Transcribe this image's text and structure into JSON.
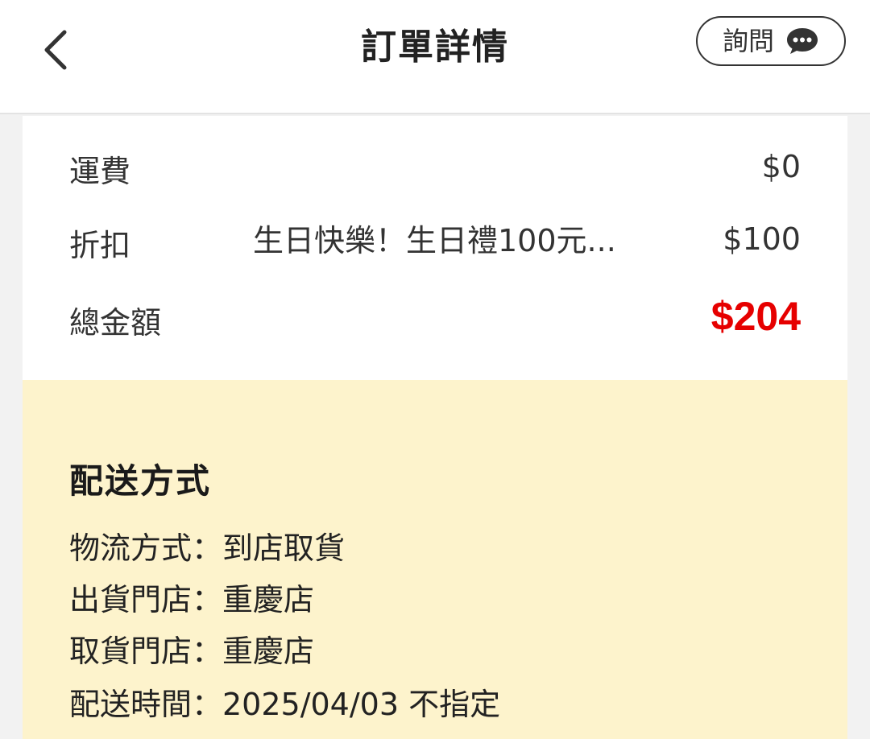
{
  "header": {
    "back_icon": "chevron-left-icon",
    "title": "訂單詳情",
    "ask_label": "詢問",
    "ask_icon": "chat-bubble-icon"
  },
  "summary": {
    "shipping_label": "運費",
    "shipping_value": "$0",
    "discount_label": "折扣",
    "discount_desc": "生日快樂！生日禮100元...",
    "discount_value": "$100",
    "total_label": "總金額",
    "total_value": "$204",
    "total_color": "#e60000"
  },
  "delivery": {
    "title": "配送方式",
    "background": "#fdf3cc",
    "lines": [
      "物流方式：到店取貨",
      "出貨門店：重慶店",
      "取貨門店：重慶店",
      "配送時間：2025/04/03 不指定"
    ]
  }
}
